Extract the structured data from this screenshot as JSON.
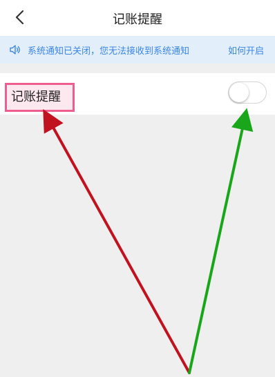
{
  "header": {
    "title": "记账提醒",
    "back_icon": "chevron-left-icon"
  },
  "notice": {
    "icon": "speaker-icon",
    "text": "系统通知已关闭，您无法接收到系统通知",
    "link_label": "如何开启"
  },
  "setting": {
    "label": "记账提醒",
    "toggle_on": false
  },
  "colors": {
    "accent": "#3a86e6",
    "notice_bg": "#e3eefb",
    "highlight_border": "#ee5d8e",
    "arrow_red": "#c0121f",
    "arrow_green": "#1aa61a",
    "page_bg": "#efefef"
  }
}
